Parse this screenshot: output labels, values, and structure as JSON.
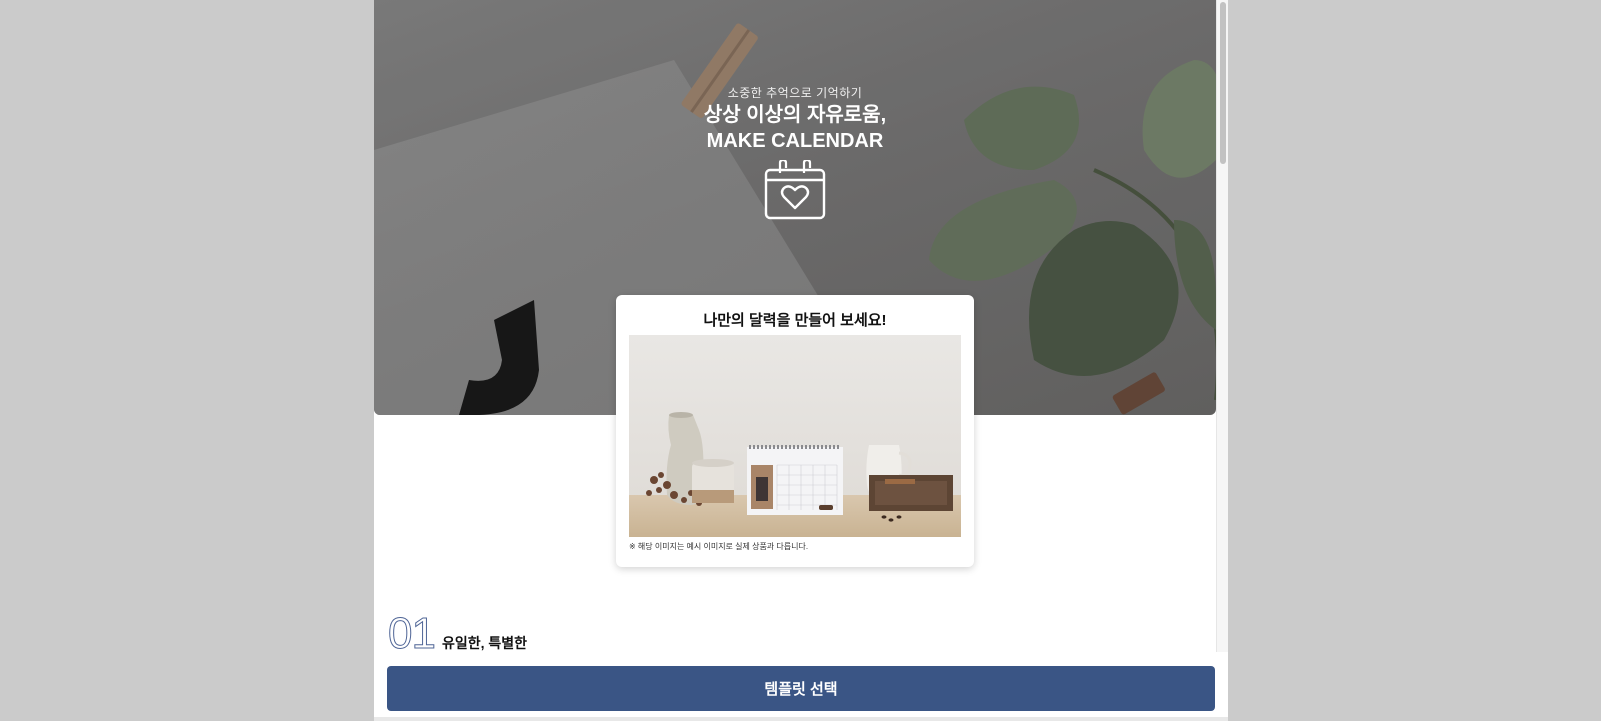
{
  "hero": {
    "subtitle": "소중한 추억으로 기억하기",
    "title_line1": "상상 이상의 자유로움,",
    "title_line2": "MAKE CALENDAR",
    "icon": "calendar-heart-icon"
  },
  "card": {
    "title": "나만의 달력을 만들어 보세요!",
    "image": "desk-calendar-photo",
    "note": "※ 해당 이미지는 예시 이미지로 실제 상품과 다릅니다."
  },
  "section": {
    "number": "01",
    "title": "유일한, 특별한"
  },
  "cta": {
    "label": "템플릿 선택"
  },
  "colors": {
    "page_background": "#cbcbcb",
    "accent": "#3a5585",
    "section_number_outline": "#4f6596"
  }
}
